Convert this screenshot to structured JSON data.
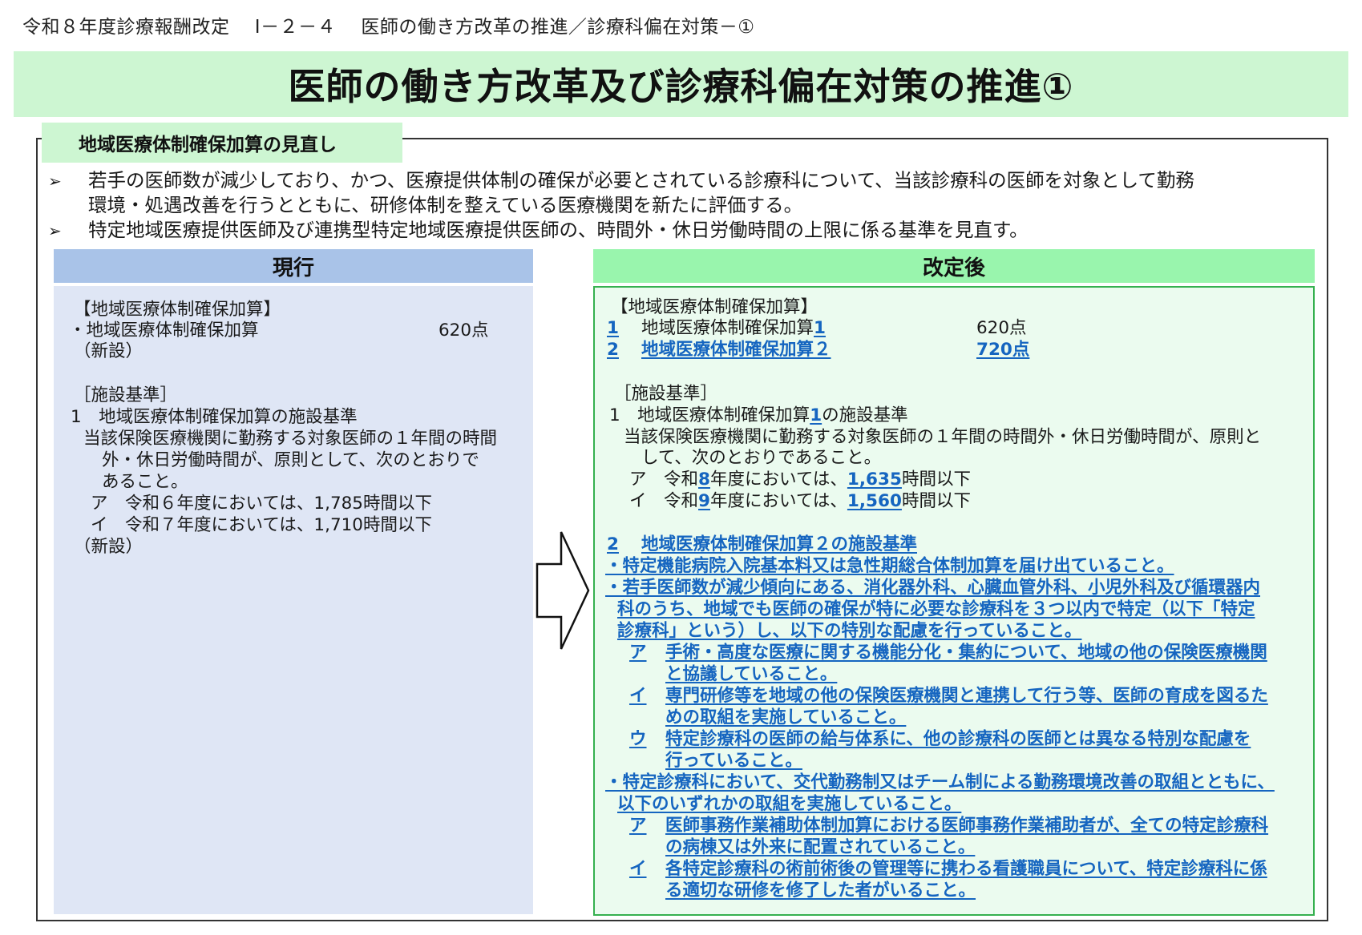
{
  "header": {
    "text": "令和８年度診療報酬改定　 Ⅰ－２－４　 医師の働き方改革の推進／診療科偏在対策－①"
  },
  "title": "医師の働き方改革及び診療科偏在対策の推進①",
  "section": {
    "tab": "地域医療体制確保加算の見直し",
    "bullets": [
      {
        "mark": "➢",
        "lines": [
          "若手の医師数が減少しており、かつ、医療提供体制の確保が必要とされている診療科について、当該診療科の医師を対象として勤務",
          "環境・処遇改善を行うとともに、研修体制を整えている医療機関を新たに評価する。"
        ]
      },
      {
        "mark": "➢",
        "lines": [
          "特定地域医療提供医師及び連携型特定地域医療提供医師の、時間外・休日労働時間の上限に係る基準を見直す。"
        ]
      }
    ]
  },
  "current": {
    "heading": "現行",
    "l1": "【地域医療体制確保加算】",
    "l2": "・地域医療体制確保加算",
    "l2_points": "620点",
    "l3": "（新設）",
    "l4": "［施設基準］",
    "l5": "1　地域医療体制確保加算の施設基準",
    "l6": "当該保険医療機関に勤務する対象医師の１年間の時間",
    "l7": "外・休日労働時間が、原則として、次のとおりで",
    "l8": "あること。",
    "l9": "ア　令和６年度においては、1,785時間以下",
    "l10": "イ　令和７年度においては、1,710時間以下",
    "l11": "（新設）"
  },
  "revised": {
    "heading": "改定後",
    "l1": "【地域医療体制確保加算】",
    "a_num": "1",
    "a_name": "地域医療体制確保加算",
    "a_num2": "1",
    "a_points": "620点",
    "b_num": "2",
    "b_name": "地域医療体制確保加算２",
    "b_points": "720点",
    "l4": "［施設基準］",
    "s1_pre": "1　地域医療体制確保加算",
    "s1_num": "1",
    "s1_post": "の施設基準",
    "s2": "当該保険医療機関に勤務する対象医師の１年間の時間外・休日労働時間が、原則と",
    "s3": "して、次のとおりであること。",
    "a_pre": "ア　令和",
    "a_year": "8",
    "a_mid": "年度においては、",
    "a_hours": "1,635",
    "a_post": "時間以下",
    "i_pre": "イ　令和",
    "i_year": "9",
    "i_mid": "年度においては、",
    "i_hours": "1,560",
    "i_post": "時間以下",
    "c_num": "2",
    "c_title": "地域医療体制確保加算２の施設基準",
    "c1": "・特定機能病院入院基本料又は急性期総合体制加算を届け出ていること。",
    "c2a": "・若手医師数が減少傾向にある、消化器外科、心臓血管外科、小児外科及び循環器内",
    "c2b": "科のうち、地域でも医師の確保が特に必要な診療科を３つ以内で特定（以下「特定",
    "c2c": "診療科」という）し、以下の特別な配慮を行っていること。",
    "c3_mark": "ア",
    "c3a": "手術・高度な医療に関する機能分化・集約について、地域の他の保険医療機関",
    "c3b": "と協議していること。",
    "c4_mark": "イ",
    "c4a": "専門研修等を地域の他の保険医療機関と連携して行う等、医師の育成を図るた",
    "c4b": "めの取組を実施していること。",
    "c5_mark": "ウ",
    "c5a": "特定診療科の医師の給与体系に、他の診療科の医師とは異なる特別な配慮を",
    "c5b": "行っていること。",
    "c6a": "・特定診療科において、交代勤務制又はチーム制による勤務環境改善の取組とともに、",
    "c6b": "以下のいずれかの取組を実施していること。",
    "c7_mark": "ア",
    "c7a": "医師事務作業補助体制加算における医師事務作業補助者が、全ての特定診療科",
    "c7b": "の病棟又は外来に配置されていること。",
    "c8_mark": "イ",
    "c8a": "各特定診療科の術前術後の管理等に携わる看護職員について、特定診療科に係",
    "c8b": "る適切な研修を修了した者がいること。"
  },
  "colors": {
    "title_band": "#cdf6d2",
    "current_head": "#a9c3e8",
    "current_body": "#dfe6f5",
    "revised_head": "#99f5ad",
    "revised_body": "#ebfbef",
    "link_blue": "#1565c0",
    "border_green": "#35b04f"
  },
  "icons": {
    "bullet": "arrowhead-bullet",
    "arrow": "right-block-arrow"
  }
}
